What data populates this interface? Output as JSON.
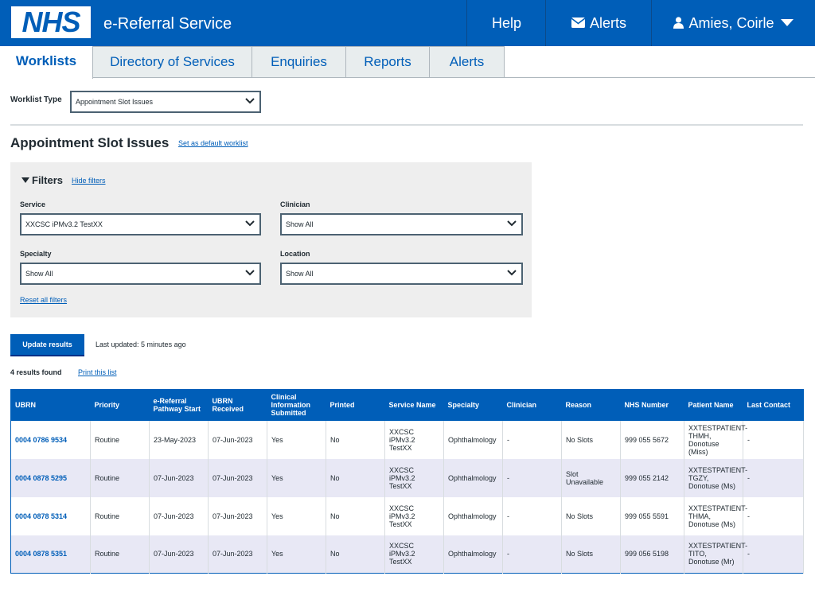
{
  "header": {
    "logo_text": "NHS",
    "service_name": "e-Referral Service",
    "help_label": "Help",
    "alerts_label": "Alerts",
    "user_name": "Amies, Coirle"
  },
  "tabs": [
    {
      "label": "Worklists",
      "active": true
    },
    {
      "label": "Directory of Services",
      "active": false
    },
    {
      "label": "Enquiries",
      "active": false
    },
    {
      "label": "Reports",
      "active": false
    },
    {
      "label": "Alerts",
      "active": false
    }
  ],
  "worklist": {
    "type_label": "Worklist Type",
    "type_value": "Appointment Slot Issues"
  },
  "page": {
    "title": "Appointment Slot Issues",
    "default_link": "Set as default worklist"
  },
  "filters": {
    "title": "Filters",
    "hide_link": "Hide filters",
    "service_label": "Service",
    "service_value": "XXCSC iPMv3.2 TestXX",
    "clinician_label": "Clinician",
    "clinician_value": "Show All",
    "specialty_label": "Specialty",
    "specialty_value": "Show All",
    "location_label": "Location",
    "location_value": "Show All",
    "reset_link": "Reset all filters"
  },
  "actions": {
    "update_label": "Update results",
    "last_updated": "Last updated: 5 minutes ago",
    "results_found": "4 results found",
    "print_link": "Print this list"
  },
  "table": {
    "headers": [
      "UBRN",
      "Priority",
      "e-Referral Pathway Start",
      "UBRN Received",
      "Clinical Information Submitted",
      "Printed",
      "Service Name",
      "Specialty",
      "Clinician",
      "Reason",
      "NHS Number",
      "Patient Name",
      "Last Contact"
    ],
    "rows": [
      [
        "0004 0786 9534",
        "Routine",
        "23-May-2023",
        "07-Jun-2023",
        "Yes",
        "No",
        "XXCSC iPMv3.2 TestXX",
        "Ophthalmology",
        "-",
        "No Slots",
        "999 055 5672",
        "XXTESTPATIENT-THMH, Donotuse (Miss)",
        "-"
      ],
      [
        "0004 0878 5295",
        "Routine",
        "07-Jun-2023",
        "07-Jun-2023",
        "Yes",
        "No",
        "XXCSC iPMv3.2 TestXX",
        "Ophthalmology",
        "-",
        "Slot Unavailable",
        "999 055 2142",
        "XXTESTPATIENT-TGZY, Donotuse (Ms)",
        "-"
      ],
      [
        "0004 0878 5314",
        "Routine",
        "07-Jun-2023",
        "07-Jun-2023",
        "Yes",
        "No",
        "XXCSC iPMv3.2 TestXX",
        "Ophthalmology",
        "-",
        "No Slots",
        "999 055 5591",
        "XXTESTPATIENT-THMA, Donotuse (Ms)",
        "-"
      ],
      [
        "0004 0878 5351",
        "Routine",
        "07-Jun-2023",
        "07-Jun-2023",
        "Yes",
        "No",
        "XXCSC iPMv3.2 TestXX",
        "Ophthalmology",
        "-",
        "No Slots",
        "999 056 5198",
        "XXTESTPATIENT-TITO, Donotuse (Mr)",
        "-"
      ]
    ]
  },
  "colors": {
    "brand_blue": "#005eb8",
    "row_alt": "#e8e8f5",
    "panel_grey": "#eeeeee"
  }
}
